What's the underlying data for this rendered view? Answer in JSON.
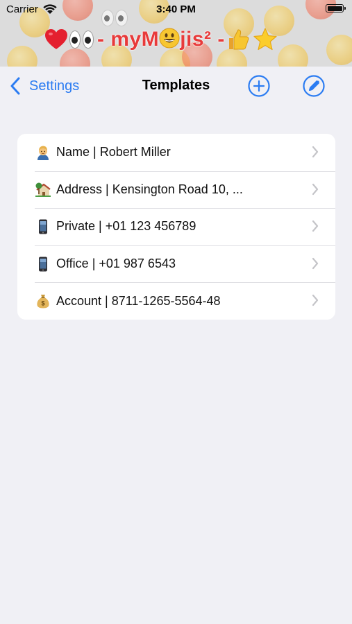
{
  "status_bar": {
    "carrier": "Carrier",
    "time": "3:40 PM"
  },
  "banner": {
    "title": "- myM",
    "title_tail": "jis² -",
    "emojis": [
      "red-heart",
      "eyes",
      "grinning-face",
      "thumbs-up",
      "star"
    ]
  },
  "navbar": {
    "back_label": "Settings",
    "title": "Templates",
    "add_icon": "plus-circle-icon",
    "edit_icon": "pencil-circle-icon"
  },
  "templates": [
    {
      "icon": "person-emoji",
      "label": "Name | Robert Miller"
    },
    {
      "icon": "house-emoji",
      "label": "Address | Kensington Road 10, ..."
    },
    {
      "icon": "mobile-phone-emoji",
      "label": "Private | +01 123 456789"
    },
    {
      "icon": "mobile-phone-emoji",
      "label": "Office | +01 987 6543"
    },
    {
      "icon": "money-bag-emoji",
      "label": "Account | 8711-1265-5564-48"
    }
  ],
  "colors": {
    "accent": "#2b7cf2",
    "title_red": "#e83a3a",
    "background": "#f0f0f5",
    "card": "#ffffff"
  }
}
